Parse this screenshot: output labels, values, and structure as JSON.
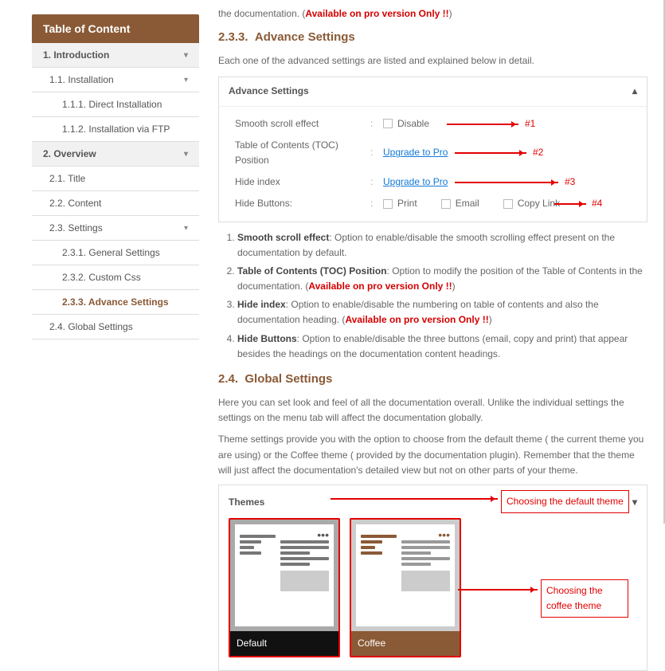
{
  "toc": {
    "header": "Table of Content",
    "items": [
      {
        "num": "1.",
        "label": "Introduction",
        "lvl": 1,
        "caret": true
      },
      {
        "num": "1.1.",
        "label": "Installation",
        "lvl": 2,
        "caret": true
      },
      {
        "num": "1.1.1.",
        "label": "Direct Installation",
        "lvl": 3
      },
      {
        "num": "1.1.2.",
        "label": "Installation via FTP",
        "lvl": 3
      },
      {
        "num": "2.",
        "label": "Overview",
        "lvl": 1,
        "caret": true
      },
      {
        "num": "2.1.",
        "label": "Title",
        "lvl": 2
      },
      {
        "num": "2.2.",
        "label": "Content",
        "lvl": 2
      },
      {
        "num": "2.3.",
        "label": "Settings",
        "lvl": 2,
        "caret": true
      },
      {
        "num": "2.3.1.",
        "label": "General Settings",
        "lvl": 3
      },
      {
        "num": "2.3.2.",
        "label": "Custom Css",
        "lvl": 3
      },
      {
        "num": "2.3.3.",
        "label": "Advance Settings",
        "lvl": 3,
        "active": true
      },
      {
        "num": "2.4.",
        "label": "Global Settings",
        "lvl": 2
      }
    ]
  },
  "top_fragment": {
    "prefix": "the documentation.  (",
    "pro": "Available on pro version Only !!",
    "suffix": ")"
  },
  "sec233": {
    "num": "2.3.3.",
    "title": "Advance Settings",
    "intro": "Each one of the advanced settings are listed and explained below in detail.",
    "panel_title": "Advance Settings",
    "rows": {
      "r1": {
        "label": "Smooth scroll effect",
        "val": "Disable",
        "tag": "#1"
      },
      "r2": {
        "label": "Table of Contents (TOC) Position",
        "val": "Upgrade to Pro",
        "tag": "#2"
      },
      "r3": {
        "label": "Hide index",
        "val": "Upgrade to Pro",
        "tag": "#3"
      },
      "r4": {
        "label": "Hide Buttons:",
        "b1": "Print",
        "b2": "Email",
        "b3": "Copy Link",
        "tag": "#4"
      }
    },
    "notes": [
      {
        "b": "Smooth scroll effect",
        "t": ": Option to enable/disable the smooth scrolling effect present on the documentation by default."
      },
      {
        "b": "Table of Contents (TOC) Position",
        "t": ": Option to modify the position of the Table of Contents in the documentation. (",
        "pro": "Available on pro version Only !!",
        "t2": ")"
      },
      {
        "b": "Hide index",
        "t": ": Option to enable/disable the numbering on table of contents and also the documentation heading. (",
        "pro": "Available on pro version Only !!",
        "t2": ")"
      },
      {
        "b": "Hide Buttons",
        "t": ": Option to enable/disable the three buttons (email, copy and print) that appear besides the headings on the documentation content headings."
      }
    ]
  },
  "sec24": {
    "num": "2.4.",
    "title": "Global Settings",
    "p1": "Here you can set look and feel of all the documentation overall. Unlike the individual settings the settings on the menu tab will affect the documentation globally.",
    "p2": "Theme settings provide you with the option to choose from the default theme ( the current theme you are using) or the Coffee theme ( provided by the documentation plugin). Remember that the theme will just affect the documentation's detailed view but not on other parts of your theme.",
    "themes_title": "Themes",
    "theme1": "Default",
    "theme2": "Coffee",
    "note1": "Choosing the default theme",
    "note2": "Choosing the coffee theme"
  }
}
